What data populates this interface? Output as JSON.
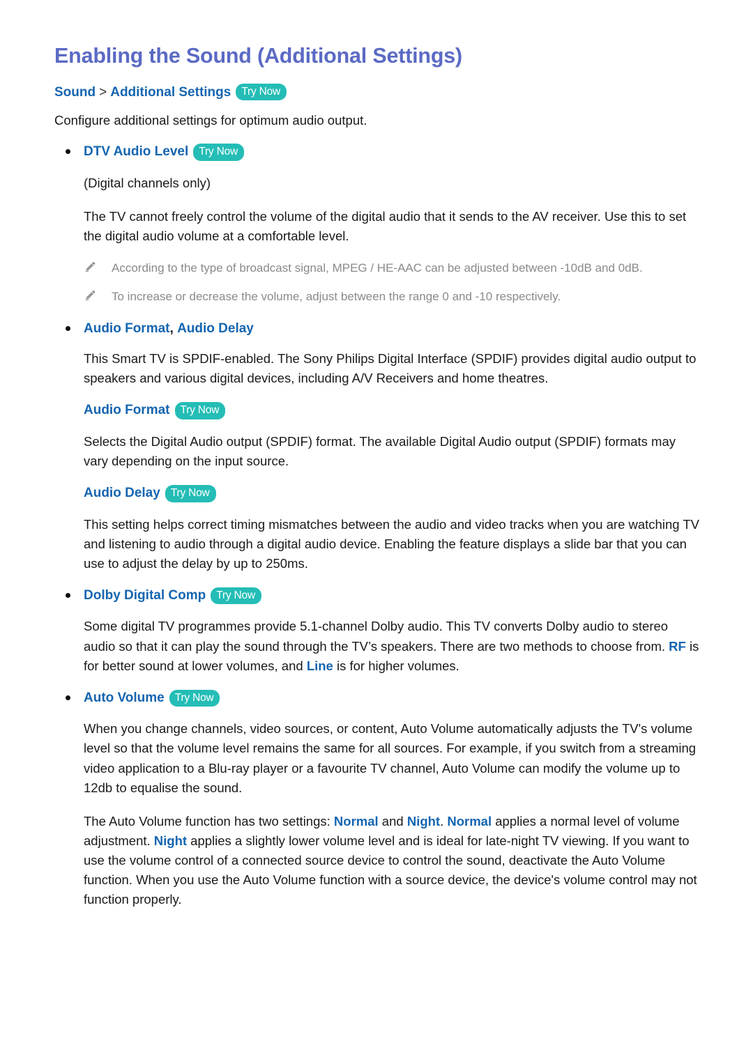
{
  "colors": {
    "title": "#5b6ac4",
    "link_blue": "#1565b0",
    "badge_teal": "#24bdb6",
    "body_text": "#1a1a1a",
    "note_text": "#8a8a8a"
  },
  "title": "Enabling the Sound (Additional Settings)",
  "breadcrumb": {
    "first": "Sound",
    "separator": ">",
    "second": "Additional Settings",
    "try_now": "Try Now"
  },
  "lead": "Configure additional settings for optimum audio output.",
  "sections": {
    "dtv_audio_level": {
      "heading": "DTV Audio Level",
      "try_now": "Try Now",
      "subtitle": "(Digital channels only)",
      "paragraph": "The TV cannot freely control the volume of the digital audio that it sends to the AV receiver. Use this to set the digital audio volume at a comfortable level.",
      "notes": [
        {
          "icon": "pencil-icon",
          "text": "According to the type of broadcast signal, MPEG / HE-AAC can be adjusted between -10dB and 0dB."
        },
        {
          "icon": "pencil-icon",
          "text": "To increase or decrease the volume, adjust between the range 0 and -10 respectively."
        }
      ]
    },
    "audio_format_delay": {
      "heading_part1": "Audio Format",
      "heading_comma": ",",
      "heading_part2": "Audio Delay",
      "paragraph": "This Smart TV is SPDIF-enabled. The Sony Philips Digital Interface (SPDIF) provides digital audio output to speakers and various digital devices, including A/V Receivers and home theatres.",
      "audio_format": {
        "heading": "Audio Format",
        "try_now": "Try Now",
        "paragraph": "Selects the Digital Audio output (SPDIF) format. The available Digital Audio output (SPDIF) formats may vary depending on the input source."
      },
      "audio_delay": {
        "heading": "Audio Delay",
        "try_now": "Try Now",
        "paragraph": "This setting helps correct timing mismatches between the audio and video tracks when you are watching TV and listening to audio through a digital audio device. Enabling the feature displays a slide bar that you can use to adjust the delay by up to 250ms."
      }
    },
    "dolby_digital_comp": {
      "heading": "Dolby Digital Comp",
      "try_now": "Try Now",
      "paragraph_part1": "Some digital TV programmes provide 5.1-channel Dolby audio. This TV converts Dolby audio to stereo audio so that it can play the sound through the TV’s speakers. There are two methods to choose from. ",
      "term_rf": "RF",
      "paragraph_part2": " is for better sound at lower volumes, and ",
      "term_line": "Line",
      "paragraph_part3": " is for higher volumes."
    },
    "auto_volume": {
      "heading": "Auto Volume",
      "try_now": "Try Now",
      "paragraph1": "When you change channels, video sources, or content, Auto Volume automatically adjusts the TV's volume level so that the volume level remains the same for all sources. For example, if you switch from a streaming video application to a Blu-ray player or a favourite TV channel, Auto Volume can modify the volume up to 12db to equalise the sound.",
      "paragraph2_part1": "The Auto Volume function has two settings: ",
      "term_normal_1": "Normal",
      "paragraph2_part2": " and ",
      "term_night_1": "Night",
      "paragraph2_part3": ". ",
      "term_normal_2": "Normal",
      "paragraph2_part4": " applies a normal level of volume adjustment. ",
      "term_night_2": "Night",
      "paragraph2_part5": " applies a slightly lower volume level and is ideal for late-night TV viewing. If you want to use the volume control of a connected source device to control the sound, deactivate the Auto Volume function. When you use the Auto Volume function with a source device, the device's volume control may not function properly."
    }
  }
}
